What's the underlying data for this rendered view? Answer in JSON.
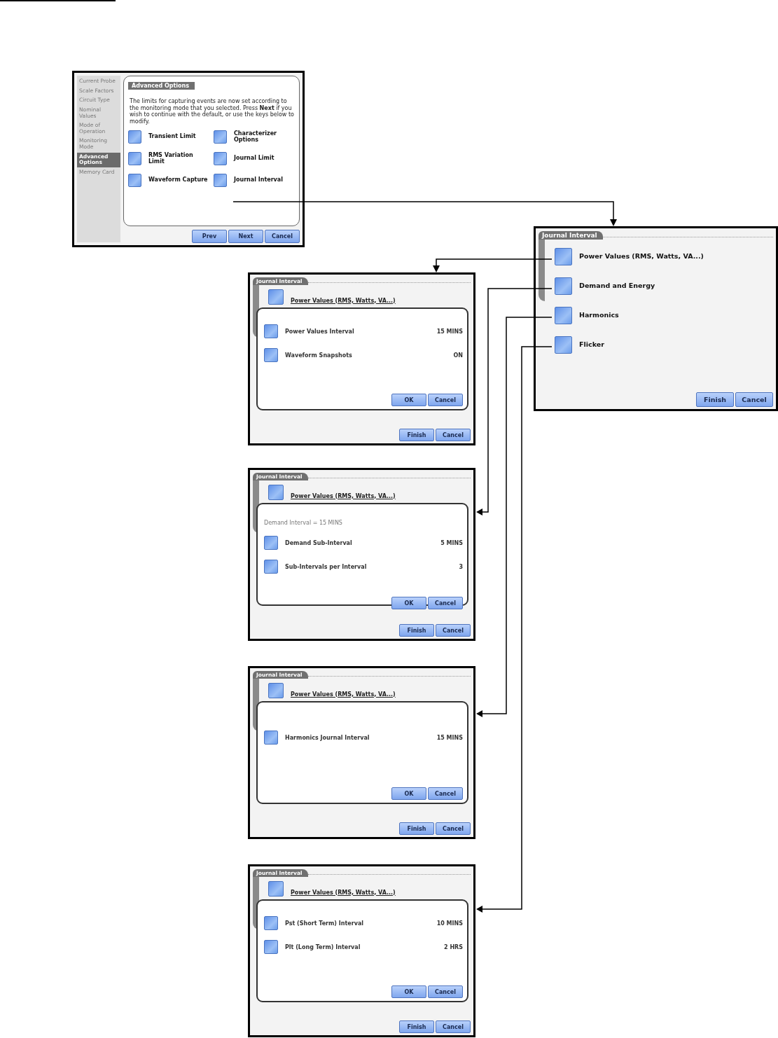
{
  "setup_screen": {
    "sidebar": [
      {
        "label": "Current Probe",
        "selected": false
      },
      {
        "label": "Scale Factors",
        "selected": false
      },
      {
        "label": "Circuit Type",
        "selected": false
      },
      {
        "label": "Nominal Values",
        "selected": false
      },
      {
        "label": "Mode of Operation",
        "selected": false
      },
      {
        "label": "Monitoring Mode",
        "selected": false
      },
      {
        "label": "Advanced Options",
        "selected": true
      },
      {
        "label": "Memory Card",
        "selected": false
      }
    ],
    "tab": "Advanced Options",
    "message": "The limits for capturing events are now set according to the monitoring mode that you selected. Press **Next** if you wish to continue with the default, or use the keys below to modify.",
    "options": [
      "Transient Limit",
      "Characterizer Options",
      "RMS Variation Limit",
      "Journal Limit",
      "Waveform Capture",
      "Journal Interval"
    ],
    "buttons": [
      "Prev",
      "Next",
      "Cancel"
    ]
  },
  "journal_interval_screen": {
    "tab": "Journal Interval",
    "options": [
      "Power Values (RMS, Watts, VA...)",
      "Demand and Energy",
      "Harmonics",
      "Flicker"
    ],
    "buttons": [
      "Finish",
      "Cancel"
    ]
  },
  "interval_dialogs": [
    {
      "tab": "Journal Interval",
      "background_option": "Power Values (RMS, Watts, VA...)",
      "rows": [
        {
          "label": "Power Values Interval",
          "value": "15 MINS"
        },
        {
          "label": "Waveform Snapshots",
          "value": "ON"
        }
      ],
      "dialog_buttons": [
        "OK",
        "Cancel"
      ],
      "buttons": [
        "Finish",
        "Cancel"
      ]
    },
    {
      "tab": "Journal Interval",
      "background_option": "Power Values (RMS, Watts, VA...)",
      "note": "Demand Interval = 15 MINS",
      "rows": [
        {
          "label": "Demand Sub-Interval",
          "value": "5 MINS"
        },
        {
          "label": "Sub-Intervals per Interval",
          "value": "3"
        }
      ],
      "dialog_buttons": [
        "OK",
        "Cancel"
      ],
      "buttons": [
        "Finish",
        "Cancel"
      ]
    },
    {
      "tab": "Journal Interval",
      "background_option": "Power Values (RMS, Watts, VA...)",
      "rows": [
        {
          "label": "Harmonics Journal Interval",
          "value": "15 MINS"
        }
      ],
      "dialog_buttons": [
        "OK",
        "Cancel"
      ],
      "buttons": [
        "Finish",
        "Cancel"
      ]
    },
    {
      "tab": "Journal Interval",
      "background_option": "Power Values (RMS, Watts, VA...)",
      "rows": [
        {
          "label": "Pst (Short Term) Interval",
          "value": "10 MINS"
        },
        {
          "label": "Plt (Long Term) Interval",
          "value": "2 HRS"
        }
      ],
      "dialog_buttons": [
        "OK",
        "Cancel"
      ],
      "buttons": [
        "Finish",
        "Cancel"
      ]
    }
  ]
}
